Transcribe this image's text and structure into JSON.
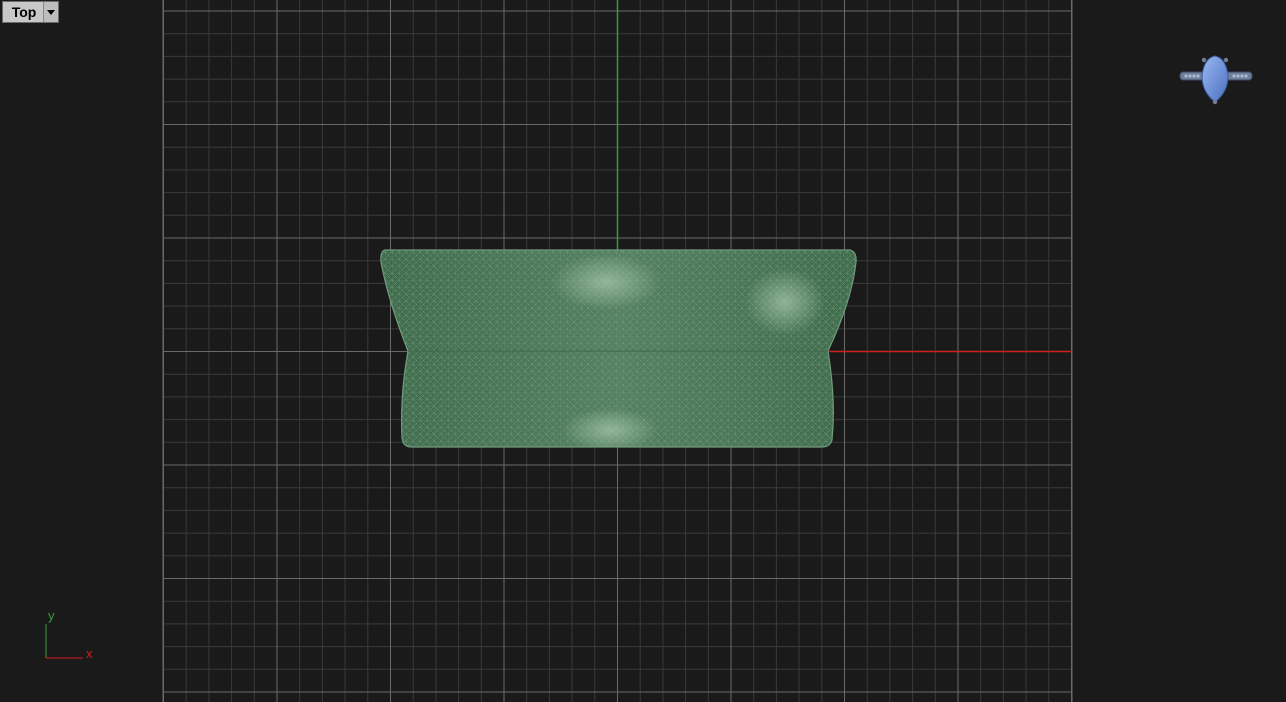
{
  "viewport": {
    "name": "Top",
    "menu_icon": "chevron-down-icon"
  },
  "axes_indicator": {
    "x_label": "x",
    "y_label": "y"
  },
  "gizmo": {
    "icon": "ring-preview-icon"
  },
  "colors": {
    "background": "#1a1a1a",
    "grid_minor": "#3a3a3a",
    "grid_major": "#6a6a6a",
    "x_axis": "#d02020",
    "y_axis": "#3c9a3c",
    "mesh_fill": "#4e7a5c",
    "mesh_line": "#6fa07c"
  }
}
